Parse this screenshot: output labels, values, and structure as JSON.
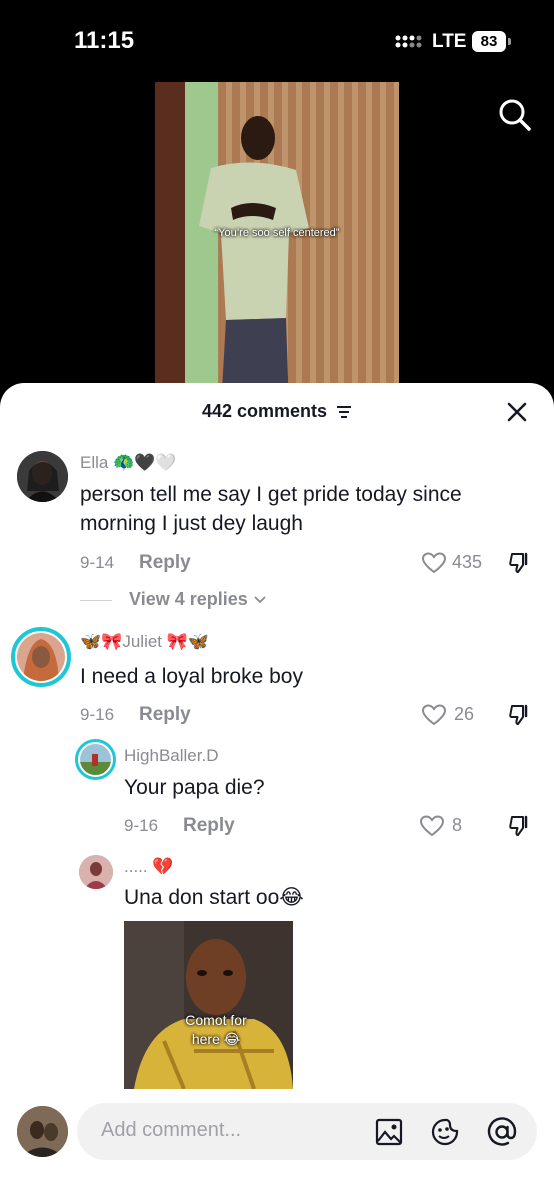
{
  "status": {
    "time": "11:15",
    "network": "LTE",
    "battery": "83"
  },
  "video": {
    "caption": "“You’re soo self centered”"
  },
  "sheet": {
    "title": "442 comments"
  },
  "comments": [
    {
      "username": "Ella 🦚🖤🤍",
      "text": "person tell me say I get pride today since morning I just dey laugh",
      "date": "9-14",
      "reply_label": "Reply",
      "likes": "435",
      "view_replies": "View 4 replies"
    },
    {
      "username": "🦋🎀Juliet 🎀🦋",
      "text": "I need a loyal broke boy",
      "date": "9-16",
      "reply_label": "Reply",
      "likes": "26"
    },
    {
      "username": "HighBaller.D",
      "text": "Your papa die?",
      "date": "9-16",
      "reply_label": "Reply",
      "likes": "8"
    },
    {
      "username": "..... 💔",
      "text": "Una don start oo😂",
      "gif_caption": "Comot for here 😂"
    }
  ],
  "input": {
    "placeholder": "Add comment..."
  },
  "icons": {
    "search": "search-icon",
    "sort": "sort-icon",
    "close": "close-icon",
    "like": "heart-outline-icon",
    "dislike": "thumbs-down-icon",
    "image": "image-icon",
    "emoji": "emoji-icon",
    "mention": "at-icon"
  }
}
